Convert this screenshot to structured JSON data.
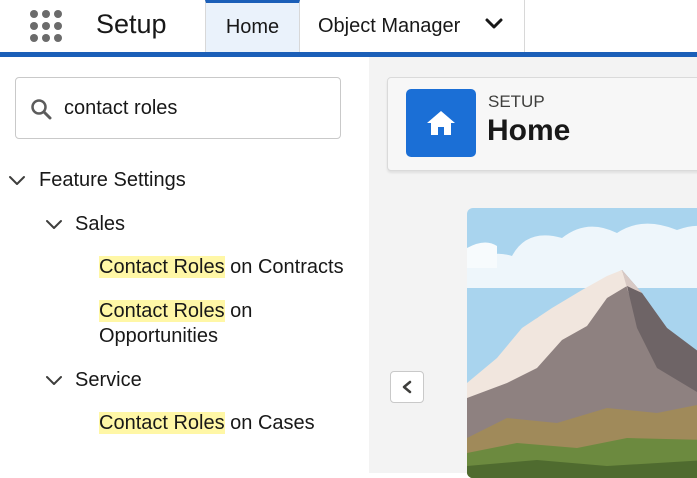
{
  "header": {
    "app_title": "Setup",
    "tabs": [
      {
        "label": "Home",
        "active": true
      },
      {
        "label": "Object Manager",
        "has_dropdown": true
      }
    ],
    "accent_color": "#1b5fb8"
  },
  "sidebar": {
    "search": {
      "value": "contact roles",
      "icon": "search-icon"
    },
    "tree": {
      "root": {
        "label": "Feature Settings",
        "expanded": true
      },
      "groups": [
        {
          "label": "Sales",
          "expanded": true,
          "items": [
            {
              "highlight": "Contact Roles",
              "rest": " on Contracts"
            },
            {
              "highlight": "Contact Roles",
              "rest": " on",
              "rest_line2": "Opportunities"
            }
          ]
        },
        {
          "label": "Service",
          "expanded": true,
          "items": [
            {
              "highlight": "Contact Roles",
              "rest": " on Cases"
            }
          ]
        }
      ]
    },
    "highlight_color": "#fff7a6"
  },
  "main": {
    "eyebrow": "SETUP",
    "title": "Home",
    "icon": "home-icon",
    "icon_color": "#1b6fd6",
    "collapse_button_icon": "chevron-left-icon"
  }
}
